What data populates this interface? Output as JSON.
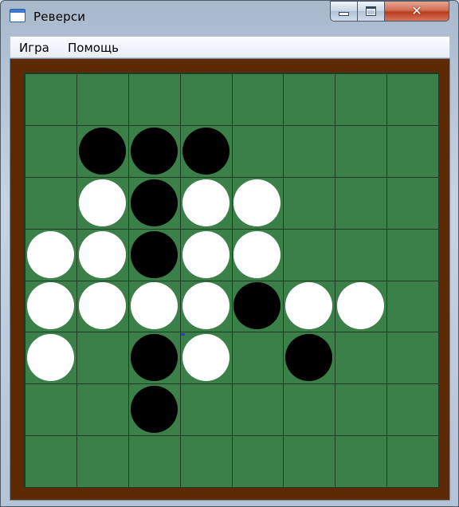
{
  "window": {
    "title": "Реверси",
    "icon": "window-icon",
    "controls": {
      "minimize_icon": "minimize-icon",
      "maximize_icon": "maximize-icon",
      "close_icon": "close-icon",
      "close_glyph": "✕"
    }
  },
  "menu": {
    "items": [
      {
        "label": "Игра"
      },
      {
        "label": "Помощь"
      }
    ]
  },
  "colors": {
    "board_green": "#3b7f49",
    "frame_brown": "#5e2a06",
    "grid_line": "#1f3d24",
    "black_disc": "#000000",
    "white_disc": "#ffffff"
  },
  "board": {
    "size": 8,
    "rows": [
      "........",
      ".BBB....",
      ".WBWW...",
      "WWBWW...",
      "WWWWBWW.",
      "W.BW.B..",
      "..B.....",
      "........"
    ]
  }
}
